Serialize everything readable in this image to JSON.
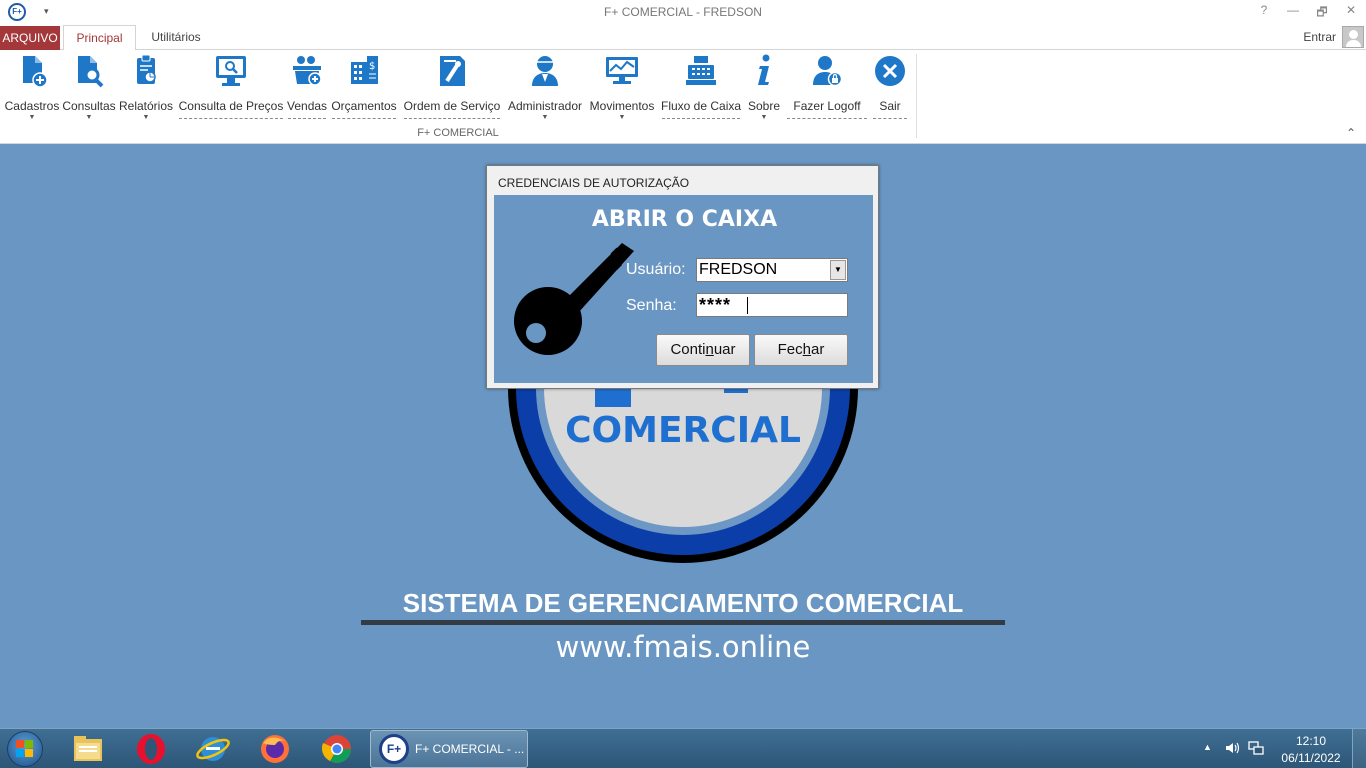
{
  "window": {
    "title": "F+ COMERCIAL - FREDSON",
    "logo_text": "F+",
    "help": "?",
    "minimize": "—",
    "restore": "🗗",
    "close": "✕",
    "quick_access": "▾"
  },
  "tabs": {
    "file": "ARQUIVO",
    "principal": "Principal",
    "utilitarios": "Utilitários",
    "signin": "Entrar"
  },
  "ribbon": {
    "group_label": "F+ COMERCIAL",
    "collapse": "⌃",
    "buttons": [
      {
        "label": "Cadastros",
        "icon": "add-document-icon"
      },
      {
        "label": "Consultas",
        "icon": "search-document-icon"
      },
      {
        "label": "Relatórios",
        "icon": "report-icon"
      },
      {
        "label": "Consulta de Preços",
        "icon": "price-monitor-icon"
      },
      {
        "label": "Vendas",
        "icon": "sales-basket-icon"
      },
      {
        "label": "Orçamentos",
        "icon": "budget-icon"
      },
      {
        "label": "Ordem de Serviço",
        "icon": "service-order-icon"
      },
      {
        "label": "Administrador",
        "icon": "admin-user-icon"
      },
      {
        "label": "Movimentos",
        "icon": "movement-chart-icon"
      },
      {
        "label": "Fluxo de Caixa",
        "icon": "cash-register-icon"
      },
      {
        "label": "Sobre",
        "icon": "info-icon"
      },
      {
        "label": "Fazer Logoff",
        "icon": "logoff-user-icon"
      },
      {
        "label": "Sair",
        "icon": "exit-icon"
      }
    ]
  },
  "splash": {
    "brand": "COMERCIAL",
    "tagline": "SISTEMA DE GERENCIAMENTO COMERCIAL",
    "website": "www.fmais.online"
  },
  "dialog": {
    "title": "CREDENCIAIS DE AUTORIZAÇÃO",
    "heading": "ABRIR O CAIXA",
    "user_label": "Usuário:",
    "user_value": "FREDSON",
    "password_label": "Senha:",
    "password_value": "****",
    "continue_pre": "Conti",
    "continue_acc": "n",
    "continue_post": "uar",
    "close_pre": "Fec",
    "close_acc": "h",
    "close_post": "ar"
  },
  "taskbar": {
    "task_label": "F+ COMERCIAL - ...",
    "task_logo": "F+",
    "time": "12:10",
    "date": "06/11/2022"
  },
  "colors": {
    "accent_red": "#a4373a",
    "ribbon_blue": "#1f77c7",
    "desktop_blue": "#6996c2",
    "brand_blue": "#1f6fd0"
  }
}
